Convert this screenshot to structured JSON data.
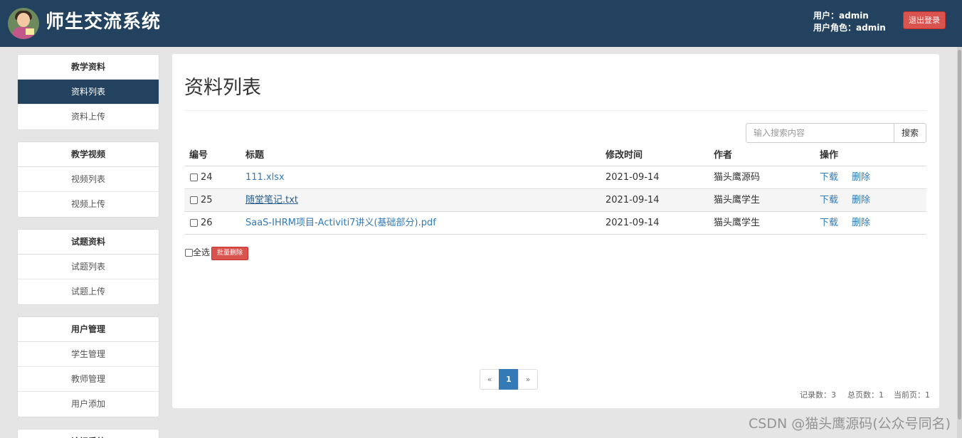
{
  "header": {
    "title": "师生交流系统",
    "user_label": "用户：admin",
    "role_label": "用户角色：admin",
    "logout_label": "退出登录"
  },
  "sidebar": {
    "groups": [
      {
        "heading": "教学资料",
        "items": [
          {
            "label": "资料列表",
            "active": true
          },
          {
            "label": "资料上传"
          }
        ]
      },
      {
        "heading": "教学视频",
        "items": [
          {
            "label": "视频列表"
          },
          {
            "label": "视频上传"
          }
        ]
      },
      {
        "heading": "试题资料",
        "items": [
          {
            "label": "试题列表"
          },
          {
            "label": "试题上传"
          }
        ]
      },
      {
        "heading": "用户管理",
        "items": [
          {
            "label": "学生管理"
          },
          {
            "label": "教师管理"
          },
          {
            "label": "用户添加"
          }
        ]
      },
      {
        "heading": "论坛系统"
      }
    ]
  },
  "main": {
    "title": "资料列表",
    "search": {
      "placeholder": "输入搜索内容",
      "button_label": "搜索"
    },
    "table": {
      "headers": {
        "id": "编号",
        "title": "标题",
        "modified": "修改时间",
        "author": "作者",
        "actions": "操作"
      },
      "rows": [
        {
          "id": "24",
          "title": "111.xlsx",
          "modified": "2021-09-14",
          "author": "猫头鹰源码",
          "download": "下载",
          "delete": "删除"
        },
        {
          "id": "25",
          "title": "随堂笔记.txt",
          "modified": "2021-09-14",
          "author": "猫头鹰学生",
          "download": "下载",
          "delete": "删除"
        },
        {
          "id": "26",
          "title": "SaaS-IHRM项目-Activiti7讲义(基础部分).pdf",
          "modified": "2021-09-14",
          "author": "猫头鹰学生",
          "download": "下载",
          "delete": "删除"
        }
      ]
    },
    "select_all_label": "全选",
    "batch_delete_label": "批量删除",
    "pagination": {
      "prev": "«",
      "current": "1",
      "next": "»"
    },
    "stats": {
      "records": "记录数：3",
      "pages": "总页数：1",
      "current": "当前页：1"
    }
  },
  "watermark": "CSDN @猫头鹰源码(公众号同名)",
  "colors": {
    "header_bg": "#23425f",
    "active_nav": "#23425f",
    "link": "#337ab7",
    "danger": "#d9534f"
  }
}
